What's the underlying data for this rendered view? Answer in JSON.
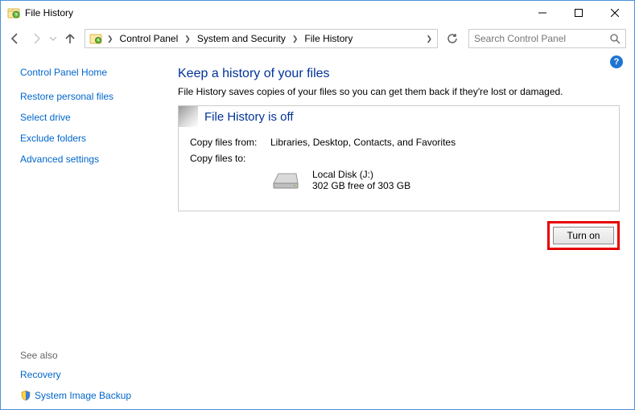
{
  "window": {
    "title": "File History"
  },
  "nav": {
    "breadcrumb": [
      "Control Panel",
      "System and Security",
      "File History"
    ],
    "search_placeholder": "Search Control Panel"
  },
  "sidebar": {
    "home": "Control Panel Home",
    "links": [
      "Restore personal files",
      "Select drive",
      "Exclude folders",
      "Advanced settings"
    ],
    "see_also_label": "See also",
    "see_also": [
      "Recovery",
      "System Image Backup"
    ]
  },
  "main": {
    "heading": "Keep a history of your files",
    "description": "File History saves copies of your files so you can get them back if they're lost or damaged.",
    "status_title": "File History is off",
    "copy_from_label": "Copy files from:",
    "copy_from_value": "Libraries, Desktop, Contacts, and Favorites",
    "copy_to_label": "Copy files to:",
    "disk_name": "Local Disk (J:)",
    "disk_free": "302 GB free of 303 GB",
    "turn_on": "Turn on"
  }
}
